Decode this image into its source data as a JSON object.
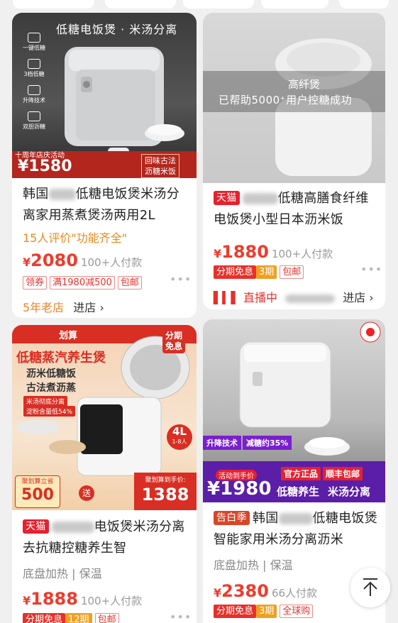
{
  "products": [
    {
      "image_banner": "低糖电饭煲 · 米汤分离",
      "features": [
        "一键低糖",
        "3档低糖",
        "升降技术",
        "双胆沥糖"
      ],
      "promo": "十周年店庆活动",
      "promo_price": "¥1580",
      "promo_slogan_1": "回味古法",
      "promo_slogan_2": "沥糖米饭",
      "title_start": "韩国",
      "title_rest": "低糖电饭煲米汤分离家用蒸煮煲汤两用2L",
      "review": "15人评价\"功能齐全\"",
      "currency": "¥",
      "price": "2080",
      "sold": "100+人付款",
      "badges": [
        "领券",
        "满1980减500",
        "包邮"
      ],
      "store_age": "5年老店",
      "store_action": "进店 ›"
    },
    {
      "overlay_line1": "高纤煲",
      "overlay_line2": "已帮助5000⁺用户控糖成功",
      "tag": "天猫",
      "title_rest": "低糖高膳食纤维电饭煲小型日本沥米饭",
      "currency": "¥",
      "price": "1880",
      "sold": "100+人付款",
      "badges": [
        "分期免息",
        "3期",
        "包邮"
      ],
      "live_label": "直播中",
      "store_action": "进店 ›"
    },
    {
      "corner_brand": "划算",
      "banner_title": "低糖蒸汽养生煲",
      "banner_sub_1": "沥米低糖饭",
      "banner_sub_2": "古法煮沥蒸",
      "chip_1": "米汤彻底分离",
      "chip_2": "淀粉含量低54%",
      "installment_1": "分期",
      "installment_2": "免息",
      "capacity": "4L",
      "capacity_sub": "1-8人",
      "juhuasuan_label": "聚划算立省",
      "saving": "500",
      "gift": "送",
      "final_label": "聚划算到手价:",
      "final_price": "1388",
      "tag": "天猫",
      "title_rest": "电饭煲米汤分离去抗糖控糖养生智",
      "features": "底盘加热 | 保温",
      "currency": "¥",
      "price": "1888",
      "sold": "100+人付款",
      "badges": [
        "分期免息",
        "12期",
        "包邮"
      ]
    },
    {
      "ribbon_1": "升降技术",
      "ribbon_2": "减糖约35%",
      "deal_label": "活动到手价",
      "deal_price": "¥1980",
      "official_1": "官方正品",
      "official_2": "顺丰包邮",
      "slogan_1": "低糖养生",
      "slogan_2": "米汤分离",
      "tag": "告白季",
      "title_start": "韩国",
      "title_rest": "低糖电饭煲智能家用米汤分离沥米",
      "features": "底盘加热 | 保温",
      "currency": "¥",
      "price": "2380",
      "sold": "66人付款",
      "badges": [
        "分期免息",
        "3期",
        "全球购"
      ]
    }
  ],
  "back_to_top": "back-to-top-icon",
  "colors": {
    "price": "#ef3b2d",
    "accent": "#e8202e",
    "review": "#e88a1a"
  }
}
